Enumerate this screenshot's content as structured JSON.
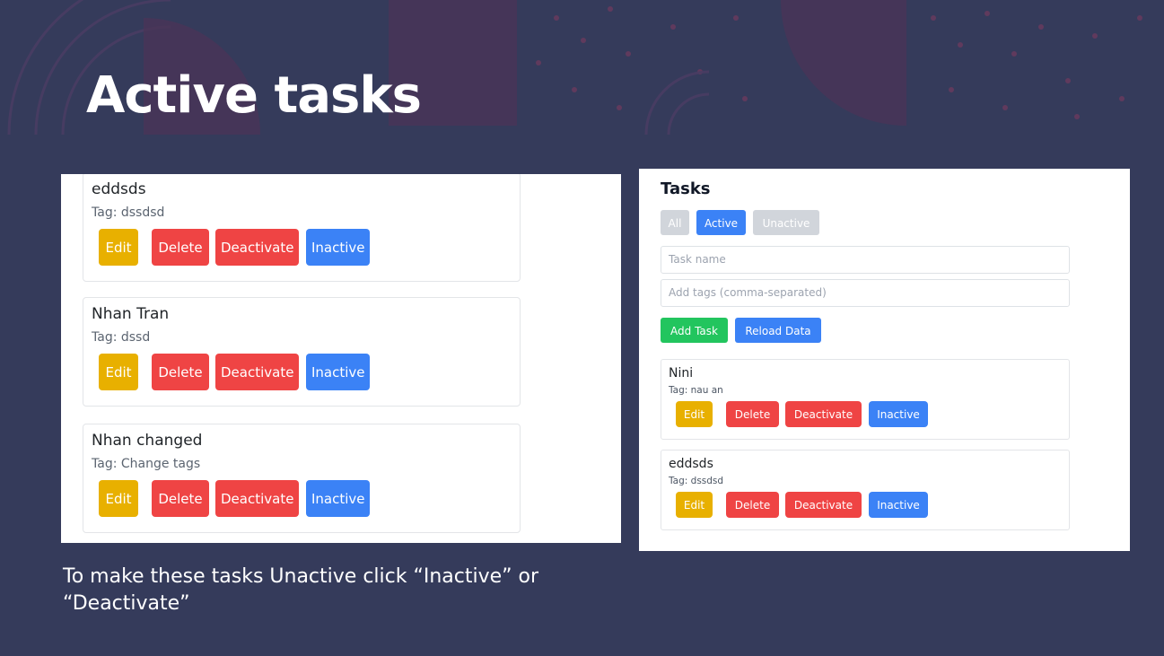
{
  "slide": {
    "title": "Active tasks",
    "caption": "To make these tasks Unactive click “Inactive” or “Deactivate”"
  },
  "left_screenshot": {
    "tasks": [
      {
        "name": "eddsds",
        "tag": "Tag: dssdsd"
      },
      {
        "name": "Nhan Tran",
        "tag": "Tag: dssd"
      },
      {
        "name": "Nhan changed",
        "tag": "Tag: Change tags"
      }
    ]
  },
  "right_screenshot": {
    "heading": "Tasks",
    "filters": [
      "All",
      "Active",
      "Unactive"
    ],
    "selected_filter": "Active",
    "task_name_placeholder": "Task name",
    "tags_placeholder": "Add tags (comma-separated)",
    "add_task_label": "Add Task",
    "reload_label": "Reload Data",
    "tasks": [
      {
        "name": "Nini",
        "tag": "Tag: nau an"
      },
      {
        "name": "eddsds",
        "tag": "Tag: dssdsd"
      }
    ]
  },
  "buttons": {
    "edit": "Edit",
    "delete": "Delete",
    "deactivate": "Deactivate",
    "inactive": "Inactive"
  },
  "colors": {
    "background": "#353b5b",
    "edit": "#e8b000",
    "delete": "#ef4444",
    "inactive": "#3b82f6",
    "add": "#22c55e",
    "filter_inactive": "#d1d5db"
  }
}
